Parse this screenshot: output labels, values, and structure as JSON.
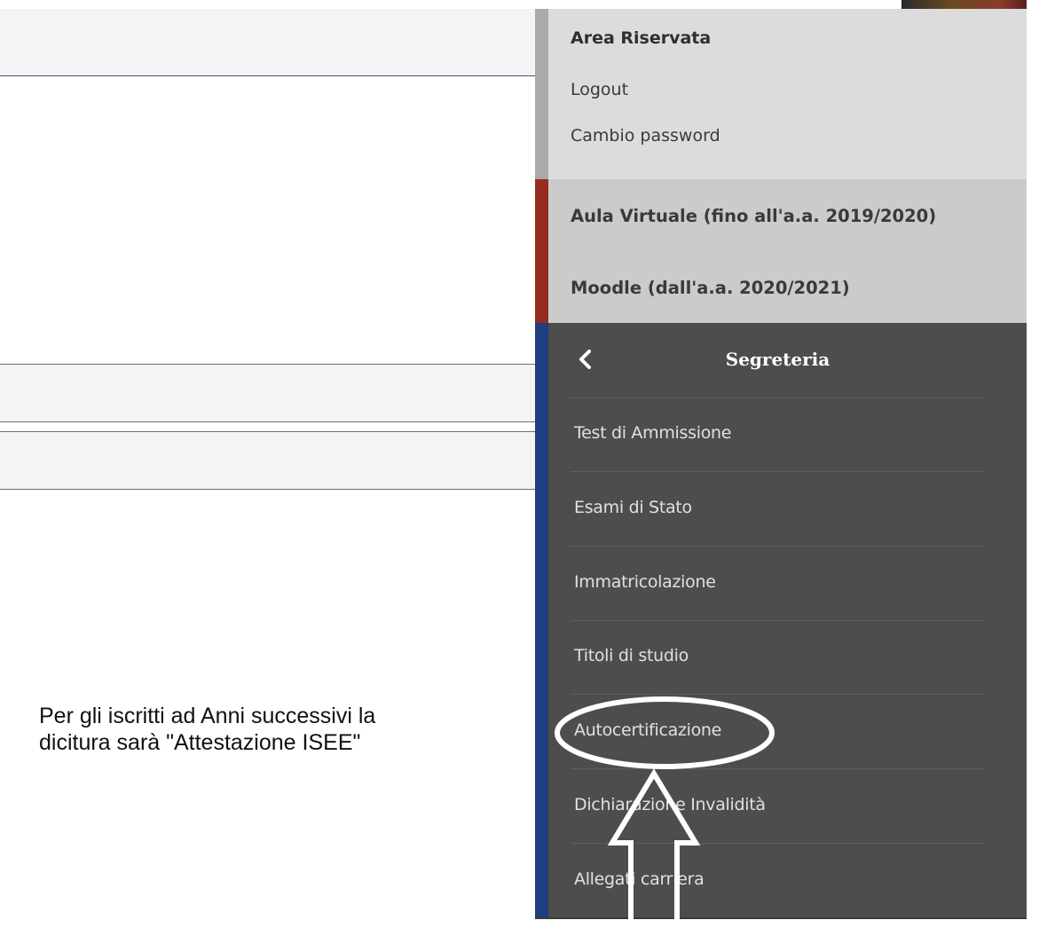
{
  "menu": {
    "area_riservata": {
      "title": "Area Riservata",
      "items": [
        "Logout",
        "Cambio password"
      ]
    },
    "aula": {
      "items": [
        "Aula Virtuale (fino all'a.a. 2019/2020)",
        "Moodle (dall'a.a. 2020/2021)"
      ]
    },
    "segreteria": {
      "title": "Segreteria",
      "back_icon": "chevron-left-icon",
      "items": [
        "Test di Ammissione",
        "Esami di Stato",
        "Immatricolazione",
        "Titoli di studio",
        "Autocertificazione",
        "Dichiarazione Invalidità",
        "Allegati carriera"
      ]
    }
  },
  "annotation": {
    "note": "Per gli iscritti ad Anni successivi la\ndicitura sarà \"Attestazione ISEE\"",
    "highlighted_item": "Autocertificazione",
    "shapes": [
      "ellipse-highlight",
      "up-arrow"
    ]
  },
  "colors": {
    "area_strip": "#aaaaaa",
    "aula_strip": "#962c1e",
    "segreteria_strip": "#1e3f80",
    "segreteria_bg": "#4d4d4d"
  }
}
